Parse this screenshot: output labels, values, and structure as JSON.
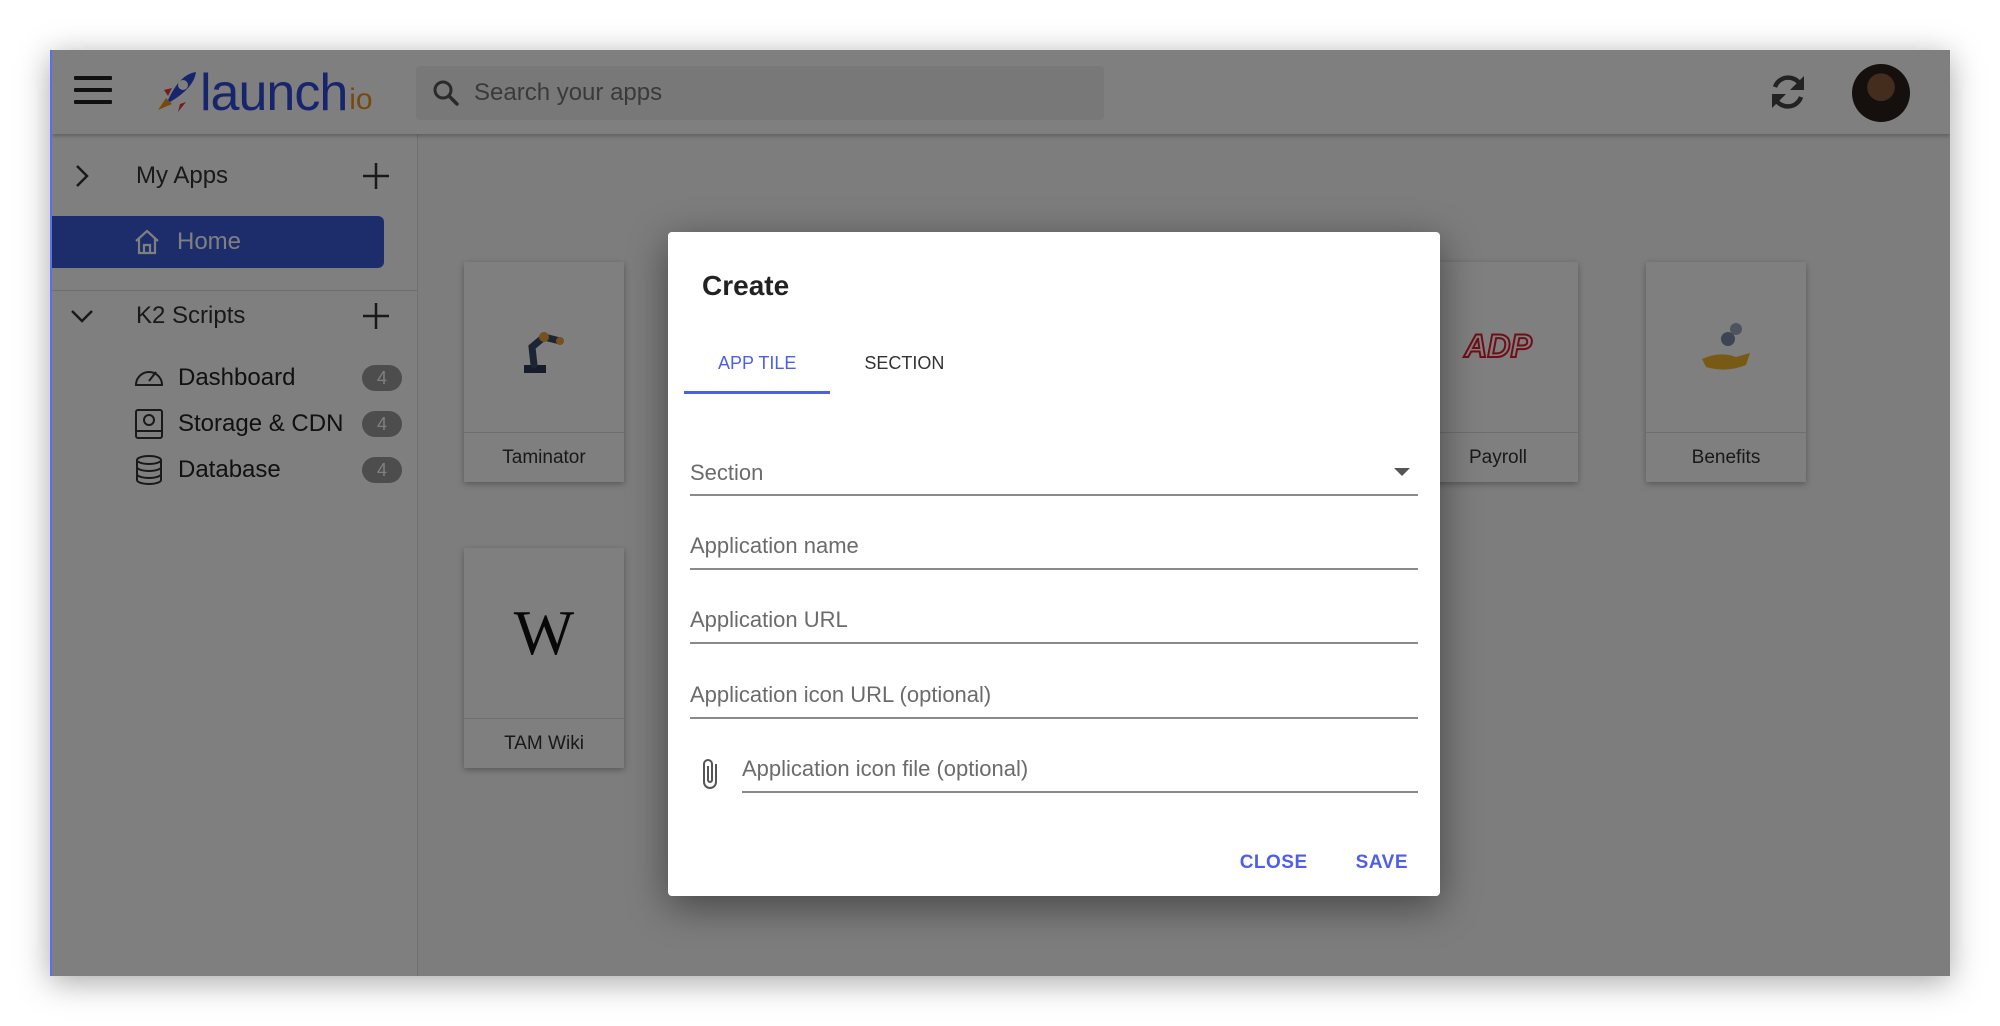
{
  "header": {
    "logo_text": "launch",
    "logo_suffix": "io",
    "search_placeholder": "Search your apps"
  },
  "sidebar": {
    "sections": [
      {
        "label": "My Apps",
        "expanded": false,
        "items": [
          {
            "label": "Home",
            "icon": "home-icon",
            "selected": true
          }
        ]
      },
      {
        "label": "K2 Scripts",
        "expanded": true,
        "items": [
          {
            "label": "Dashboard",
            "icon": "speedometer-icon",
            "count": "4"
          },
          {
            "label": "Storage & CDN",
            "icon": "hard-drive-icon",
            "count": "4"
          },
          {
            "label": "Database",
            "icon": "database-icon",
            "count": "4"
          }
        ]
      }
    ]
  },
  "tiles": [
    {
      "label": "Taminator",
      "icon": "robot-arm-icon"
    },
    {
      "label": "Payroll",
      "icon": "adp-logo-icon"
    },
    {
      "label": "Benefits",
      "icon": "coins-hand-icon"
    },
    {
      "label": "TAM Wiki",
      "icon": "wikipedia-icon",
      "glyph": "W"
    }
  ],
  "dialog": {
    "title": "Create",
    "tabs": [
      {
        "label": "APP TILE",
        "active": true
      },
      {
        "label": "SECTION",
        "active": false
      }
    ],
    "section_select_label": "Section",
    "fields": {
      "app_name_placeholder": "Application name",
      "app_url_placeholder": "Application URL",
      "icon_url_placeholder": "Application icon URL (optional)",
      "icon_file_placeholder": "Application icon file (optional)"
    },
    "close_label": "CLOSE",
    "save_label": "SAVE"
  },
  "colors": {
    "accent": "#4d5fea",
    "brand": "#2f4bd8",
    "sidebar_selected": "#3a5ad8"
  }
}
